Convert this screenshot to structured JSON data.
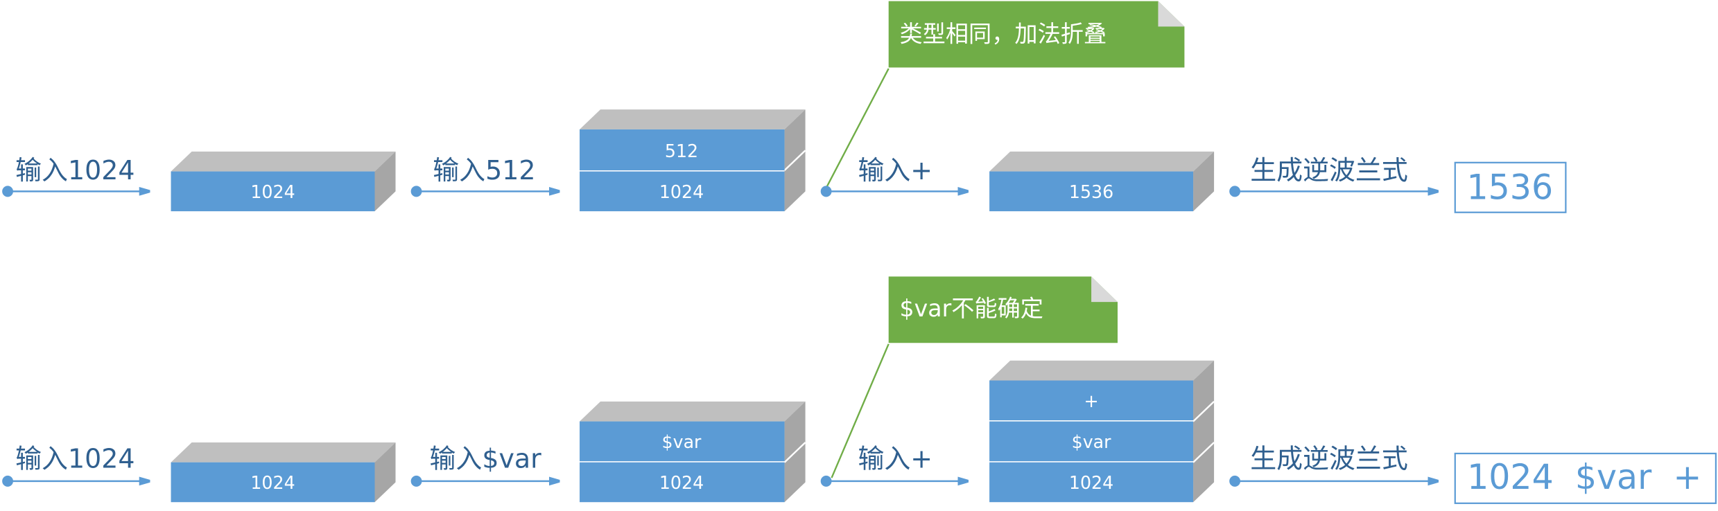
{
  "colors": {
    "block_face": "#5b9bd5",
    "block_top": "#bfbfbf",
    "block_side": "#a6a6a6",
    "arrow": "#5b9bd5",
    "arrow_label": "#2f5f8f",
    "note_fill": "#70ad47",
    "note_fold": "#d9d9d9",
    "result_border": "#5b9bd5",
    "result_text": "#5b9bd5"
  },
  "rows": [
    {
      "arrows": [
        "输入1024",
        "输入512",
        "输入+",
        "生成逆波兰式"
      ],
      "stacks": [
        [
          "1024"
        ],
        [
          "512",
          "1024"
        ],
        [
          "1536"
        ]
      ],
      "note": "类型相同，加法折叠",
      "result": "1536"
    },
    {
      "arrows": [
        "输入1024",
        "输入$var",
        "输入+",
        "生成逆波兰式"
      ],
      "stacks": [
        [
          "1024"
        ],
        [
          "$var",
          "1024"
        ],
        [
          "+",
          "$var",
          "1024"
        ]
      ],
      "note": "$var不能确定",
      "result": "1024  $var  +"
    }
  ]
}
